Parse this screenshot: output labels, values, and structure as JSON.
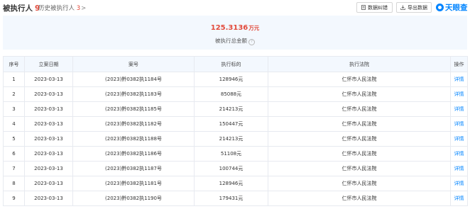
{
  "header": {
    "title": "被执行人",
    "title_count": "9",
    "history_label": "历史被执行人",
    "history_count": "3",
    "history_arrow": ">",
    "error_button": "数据纠错",
    "export_button": "导出数据",
    "logo_text": "天眼查",
    "accent_color": "#0084ff",
    "highlight_color": "#e24a3b"
  },
  "summary": {
    "total_value": "125.3136",
    "total_unit": "万元",
    "total_label": "被执行总金额",
    "help_glyph": "?"
  },
  "table": {
    "columns": [
      "序号",
      "立案日期",
      "案号",
      "执行标的",
      "执行法院",
      "操作"
    ],
    "rows": [
      {
        "index": "1",
        "date": "2023-03-13",
        "case_no": "(2023)黔0382执1184号",
        "amount": "128946元",
        "court": "仁怀市人民法院",
        "action": "详情"
      },
      {
        "index": "2",
        "date": "2023-03-13",
        "case_no": "(2023)黔0382执1183号",
        "amount": "85088元",
        "court": "仁怀市人民法院",
        "action": "详情"
      },
      {
        "index": "3",
        "date": "2023-03-13",
        "case_no": "(2023)黔0382执1185号",
        "amount": "214213元",
        "court": "仁怀市人民法院",
        "action": "详情"
      },
      {
        "index": "4",
        "date": "2023-03-13",
        "case_no": "(2023)黔0382执1182号",
        "amount": "150447元",
        "court": "仁怀市人民法院",
        "action": "详情"
      },
      {
        "index": "5",
        "date": "2023-03-13",
        "case_no": "(2023)黔0382执1188号",
        "amount": "214213元",
        "court": "仁怀市人民法院",
        "action": "详情"
      },
      {
        "index": "6",
        "date": "2023-03-13",
        "case_no": "(2023)黔0382执1186号",
        "amount": "51108元",
        "court": "仁怀市人民法院",
        "action": "详情"
      },
      {
        "index": "7",
        "date": "2023-03-13",
        "case_no": "(2023)黔0382执1187号",
        "amount": "100744元",
        "court": "仁怀市人民法院",
        "action": "详情"
      },
      {
        "index": "8",
        "date": "2023-03-13",
        "case_no": "(2023)黔0382执1181号",
        "amount": "128946元",
        "court": "仁怀市人民法院",
        "action": "详情"
      },
      {
        "index": "9",
        "date": "2023-03-13",
        "case_no": "(2023)黔0382执1190号",
        "amount": "179431元",
        "court": "仁怀市人民法院",
        "action": "详情"
      }
    ]
  }
}
